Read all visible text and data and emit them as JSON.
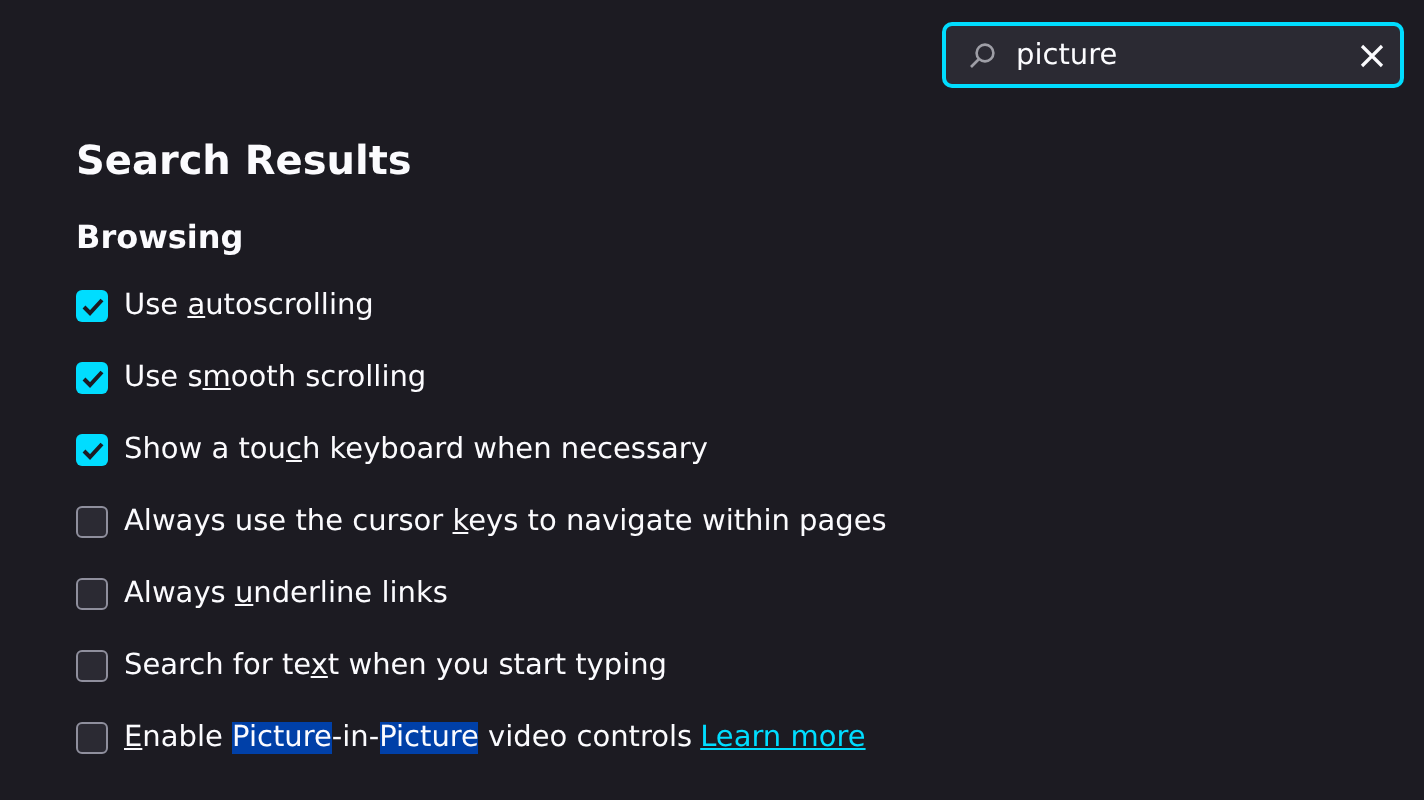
{
  "search": {
    "value": "picture"
  },
  "title": "Search Results",
  "section": {
    "title": "Browsing",
    "options": [
      {
        "checked": true,
        "parts": [
          {
            "text": "Use ",
            "kind": "plain"
          },
          {
            "text": "a",
            "kind": "accesskey"
          },
          {
            "text": "utoscrolling",
            "kind": "plain"
          }
        ]
      },
      {
        "checked": true,
        "parts": [
          {
            "text": "Use s",
            "kind": "plain"
          },
          {
            "text": "m",
            "kind": "accesskey"
          },
          {
            "text": "ooth scrolling",
            "kind": "plain"
          }
        ]
      },
      {
        "checked": true,
        "parts": [
          {
            "text": "Show a tou",
            "kind": "plain"
          },
          {
            "text": "c",
            "kind": "accesskey"
          },
          {
            "text": "h keyboard when necessary",
            "kind": "plain"
          }
        ]
      },
      {
        "checked": false,
        "parts": [
          {
            "text": "Always use the cursor ",
            "kind": "plain"
          },
          {
            "text": "k",
            "kind": "accesskey"
          },
          {
            "text": "eys to navigate within pages",
            "kind": "plain"
          }
        ]
      },
      {
        "checked": false,
        "parts": [
          {
            "text": "Always ",
            "kind": "plain"
          },
          {
            "text": "u",
            "kind": "accesskey"
          },
          {
            "text": "nderline links",
            "kind": "plain"
          }
        ]
      },
      {
        "checked": false,
        "parts": [
          {
            "text": "Search for te",
            "kind": "plain"
          },
          {
            "text": "x",
            "kind": "accesskey"
          },
          {
            "text": "t when you start typing",
            "kind": "plain"
          }
        ]
      },
      {
        "checked": false,
        "parts": [
          {
            "text": "E",
            "kind": "accesskey"
          },
          {
            "text": "nable ",
            "kind": "plain"
          },
          {
            "text": "Picture",
            "kind": "highlight"
          },
          {
            "text": "-in-",
            "kind": "plain"
          },
          {
            "text": "Picture",
            "kind": "highlight"
          },
          {
            "text": " video controls",
            "kind": "plain"
          }
        ],
        "link": "Learn more"
      }
    ]
  }
}
